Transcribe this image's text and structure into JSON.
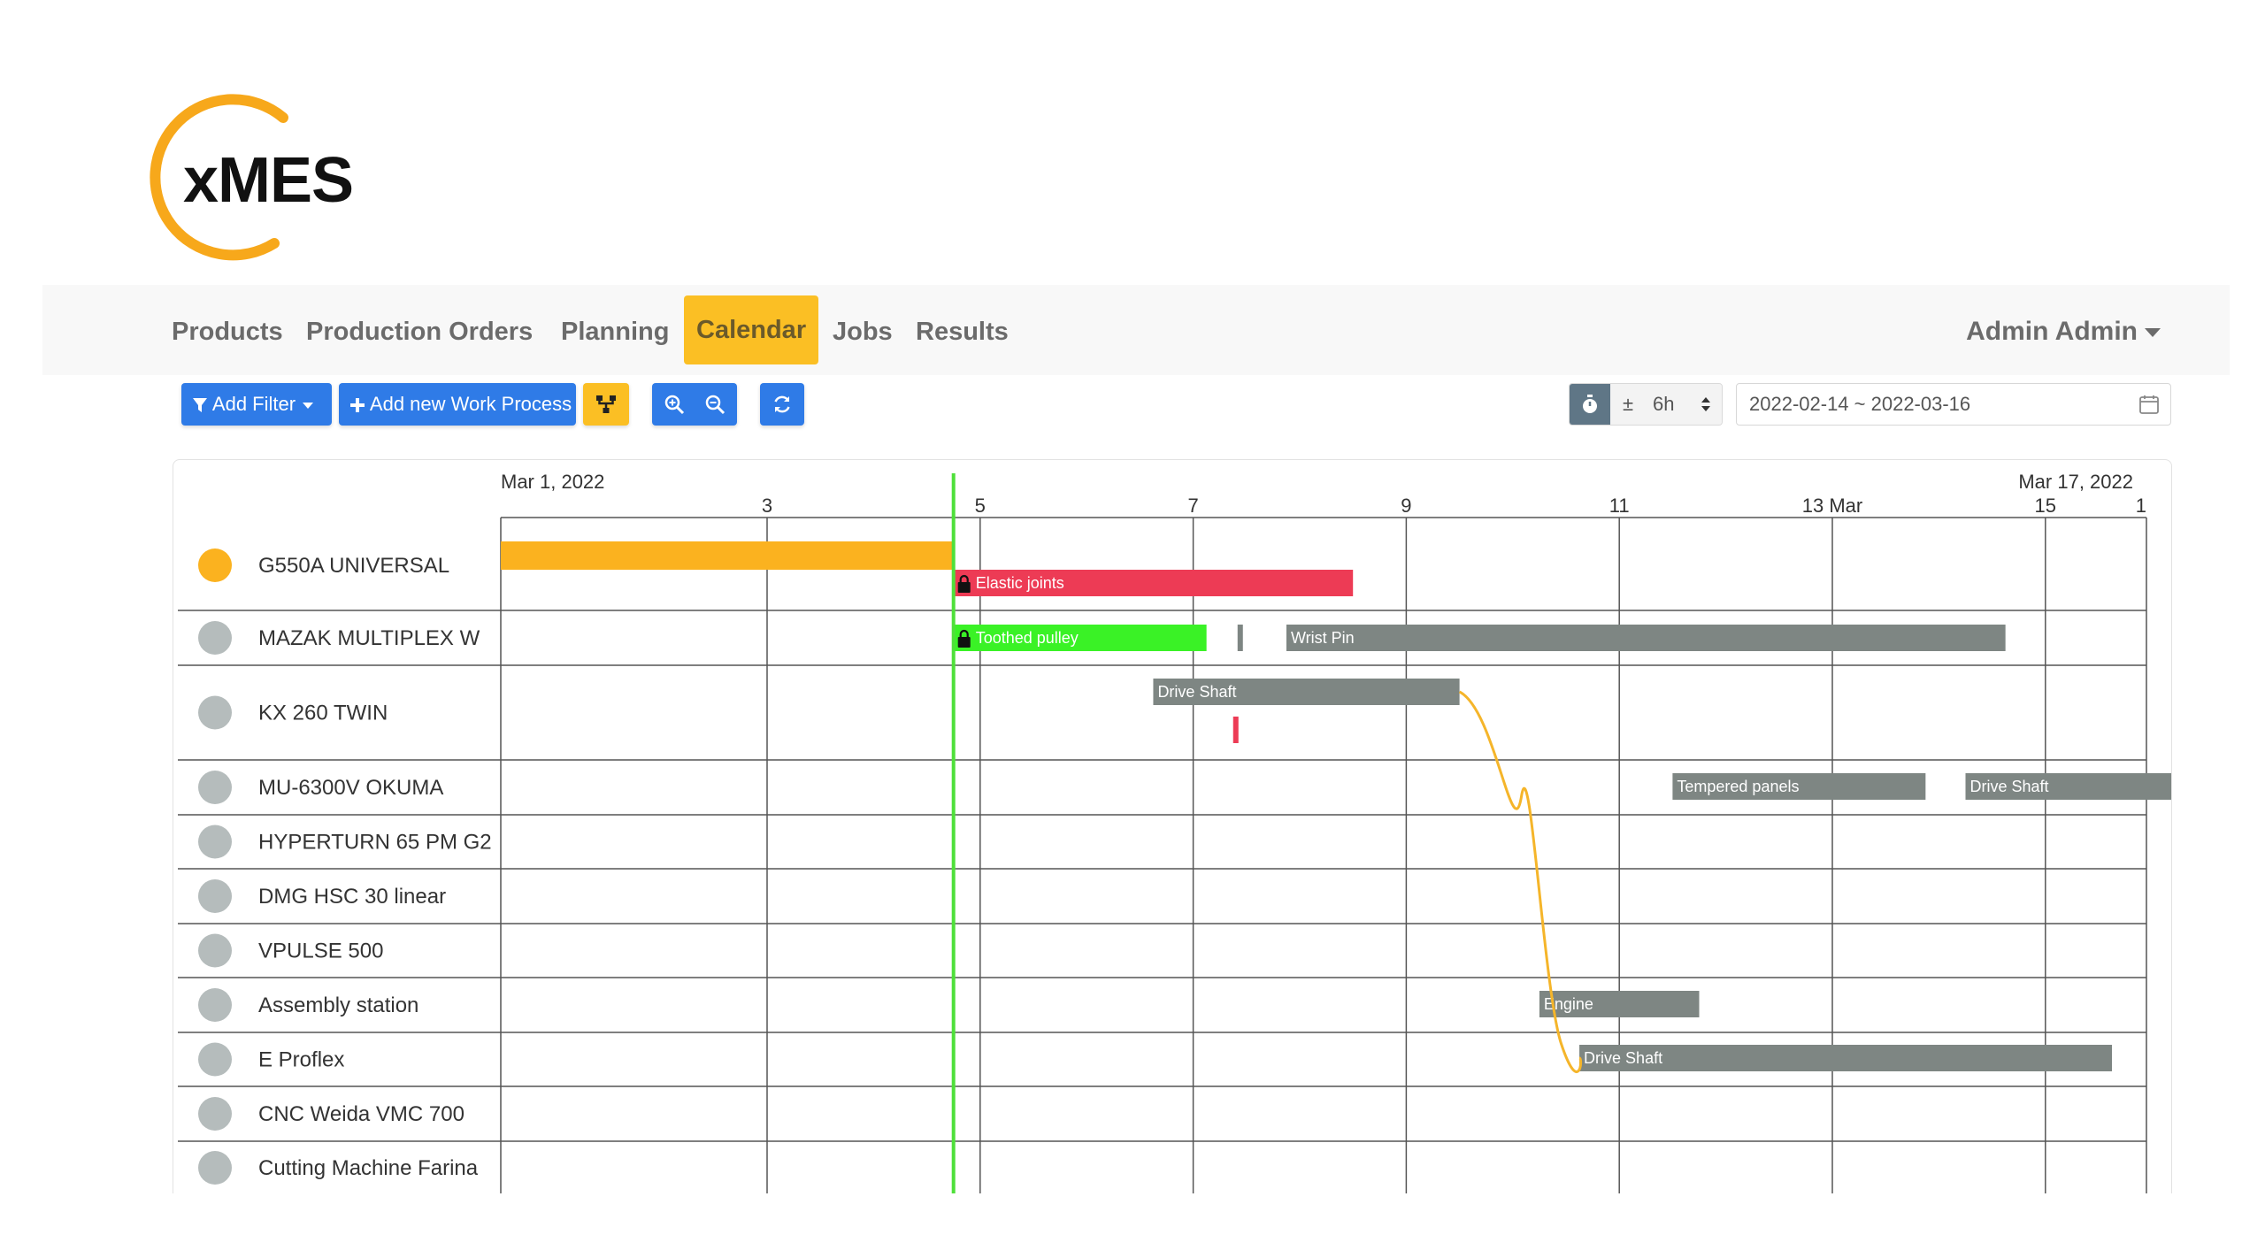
{
  "logo": {
    "text": "xMES",
    "color": "#f7a81b"
  },
  "nav": {
    "items": [
      {
        "label": "Products",
        "active": false
      },
      {
        "label": "Production Orders",
        "active": false
      },
      {
        "label": "Planning",
        "active": false
      },
      {
        "label": "Calendar",
        "active": true
      },
      {
        "label": "Jobs",
        "active": false
      },
      {
        "label": "Results",
        "active": false
      }
    ],
    "user": "Admin Admin"
  },
  "toolbar": {
    "add_filter": "Add Filter",
    "add_process": "Add new Work Process",
    "interval_prefix": "±",
    "interval_value": "6h",
    "date_range": "2022-02-14 ~ 2022-03-16"
  },
  "gantt": {
    "header": {
      "start_label": "Mar 1, 2022",
      "end_label": "Mar 17, 2022"
    },
    "ticks": [
      "3",
      "5",
      "7",
      "9",
      "11",
      "13 Mar",
      "15",
      "1"
    ],
    "resources": [
      {
        "name": "G550A UNIVERSAL",
        "status_color": "#fbb21f"
      },
      {
        "name": "MAZAK MULTIPLEX W",
        "status_color": "#b5bcbc"
      },
      {
        "name": "KX 260 TWIN",
        "status_color": "#b5bcbc"
      },
      {
        "name": "MU-6300V OKUMA",
        "status_color": "#b5bcbc"
      },
      {
        "name": "HYPERTURN 65 PM G2",
        "status_color": "#b5bcbc"
      },
      {
        "name": "DMG HSC 30 linear",
        "status_color": "#b5bcbc"
      },
      {
        "name": "VPULSE 500",
        "status_color": "#b5bcbc"
      },
      {
        "name": "Assembly station",
        "status_color": "#b5bcbc"
      },
      {
        "name": "E Proflex",
        "status_color": "#b5bcbc"
      },
      {
        "name": "CNC Weida VMC 700",
        "status_color": "#b5bcbc"
      },
      {
        "name": "Cutting Machine Farina",
        "status_color": "#b5bcbc"
      }
    ],
    "tasks": [
      {
        "label": "",
        "resource": 0,
        "start": "2022-02-27 00:00",
        "end": "2022-03-04 18:00",
        "color": "#fbb21f",
        "locked": false
      },
      {
        "label": "Elastic joints",
        "resource": 0,
        "start": "2022-03-04 18:00",
        "end": "2022-03-08 12:00",
        "color": "#ed3b55",
        "locked": true
      },
      {
        "label": "Toothed pulley",
        "resource": 1,
        "start": "2022-03-04 18:00",
        "end": "2022-03-07 03:00",
        "color": "#3af226",
        "locked": true
      },
      {
        "label": "",
        "resource": 1,
        "start": "2022-03-07 10:00",
        "end": "2022-03-07 11:00",
        "color": "#7e8683",
        "locked": false
      },
      {
        "label": "Wrist Pin",
        "resource": 1,
        "start": "2022-03-07 21:00",
        "end": "2022-03-14 15:00",
        "color": "#7e8683",
        "locked": false
      },
      {
        "label": "Drive Shaft",
        "resource": 2,
        "start": "2022-03-06 15:00",
        "end": "2022-03-09 12:00",
        "color": "#7e8683",
        "locked": false
      },
      {
        "label": "",
        "resource": 2,
        "start": "2022-03-07 09:00",
        "end": "2022-03-07 10:00",
        "color": "#ed3b55",
        "locked": false
      },
      {
        "label": "Tempered panels",
        "resource": 3,
        "start": "2022-03-11 12:00",
        "end": "2022-03-13 21:00",
        "color": "#7e8683",
        "locked": false
      },
      {
        "label": "Drive Shaft",
        "resource": 3,
        "start": "2022-03-14 06:00",
        "end": "2022-03-16 18:00",
        "color": "#7e8683",
        "locked": false
      },
      {
        "label": "Engine",
        "resource": 7,
        "start": "2022-03-10 06:00",
        "end": "2022-03-11 18:00",
        "color": "#7e8683",
        "locked": false
      },
      {
        "label": "Drive Shaft",
        "resource": 8,
        "start": "2022-03-10 15:00",
        "end": "2022-03-15 15:00",
        "color": "#7e8683",
        "locked": false
      }
    ],
    "today": "2022-03-04 18:00",
    "today_color": "#4fe03a",
    "dependency_color": "#f5b52a"
  }
}
